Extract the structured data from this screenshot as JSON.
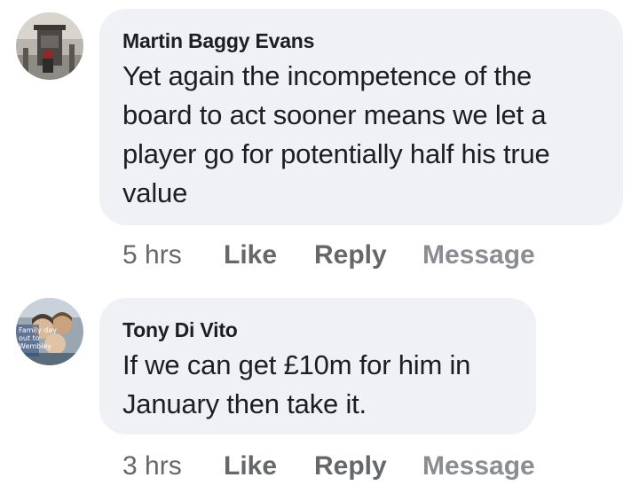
{
  "comments": [
    {
      "author": "Martin Baggy Evans",
      "text": "Yet again the incompetence of the board to act sooner means we let a player go for potentially half his true value",
      "time": "5 hrs",
      "like_label": "Like",
      "reply_label": "Reply",
      "message_label": "Message",
      "avatar_icon": "profile-photo-icon"
    },
    {
      "author": "Tony Di Vito",
      "text": "If we can get £10m for him in January then take it.",
      "time": "3 hrs",
      "like_label": "Like",
      "reply_label": "Reply",
      "message_label": "Message",
      "avatar_icon": "profile-photo-icon",
      "avatar_overlay_text": "Family day out to Wembley"
    }
  ],
  "colors": {
    "bubble": "#eff1f4",
    "text": "#1c1e21",
    "secondary": "#65676b",
    "muted": "#8a8d91"
  }
}
